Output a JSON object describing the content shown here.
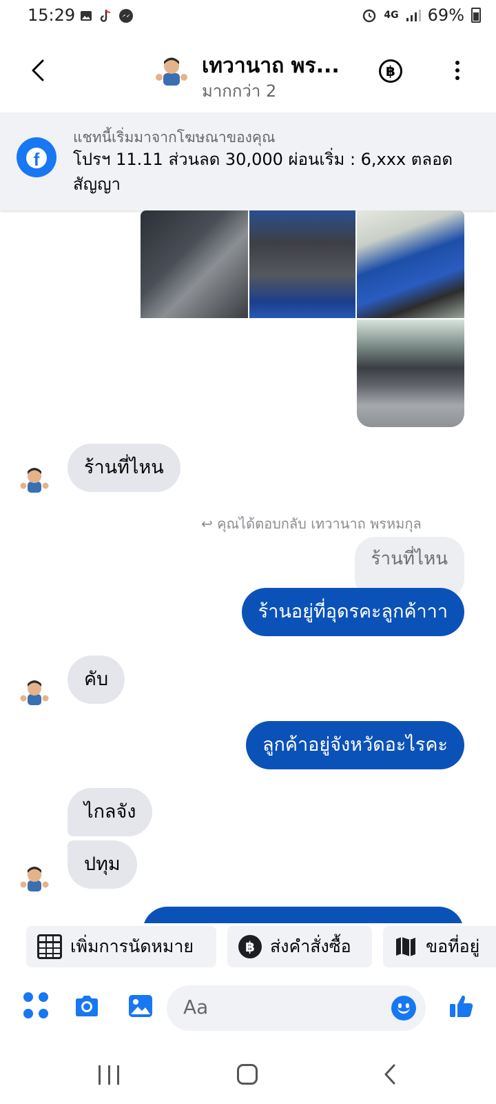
{
  "status_bar": {
    "time": "15:29",
    "network": "4G",
    "battery": "69%",
    "left_icons": [
      "gallery-icon",
      "tiktok-icon",
      "messenger-icon"
    ],
    "right_icons": [
      "alarm-icon",
      "data-icon",
      "signal-icon",
      "battery-icon"
    ]
  },
  "header": {
    "contact_name": "เทวานาถ พร...",
    "subtitle": "มากกว่า 2",
    "baht_symbol": "฿"
  },
  "ad_banner": {
    "label": "แชทนี้เริ่มมาจากโฆษณาของคุณ",
    "text": "โปรฯ 11.11 ส่วนลด 30,000 ผ่อนเริ่ม : 6,xxx ตลอดสัญญา"
  },
  "messages": {
    "in_1": "ร้านที่ไหน",
    "reply_note": "คุณได้ตอบกลับ เทวานาถ พรหมกุล",
    "quoted": "ร้านที่ไหน",
    "out_1": "ร้านอยู่ที่อุดรคะลูกค้าาา",
    "in_2": "คับ",
    "out_2": "ลูกค้าอยู่จังหวัดอะไรคะ",
    "in_3": "ไกลจัง",
    "in_4": "ปทุม"
  },
  "quick_actions": {
    "appointment": "เพิ่มการนัดหมาย",
    "order": "ส่งคำสั่งซื้อ",
    "address": "ขอที่อยู่",
    "baht_symbol": "฿"
  },
  "composer": {
    "placeholder": "Aa"
  },
  "colors": {
    "accent": "#1877f2",
    "outgoing_bubble": "#0b52b8",
    "incoming_bubble": "#e4e6eb"
  }
}
